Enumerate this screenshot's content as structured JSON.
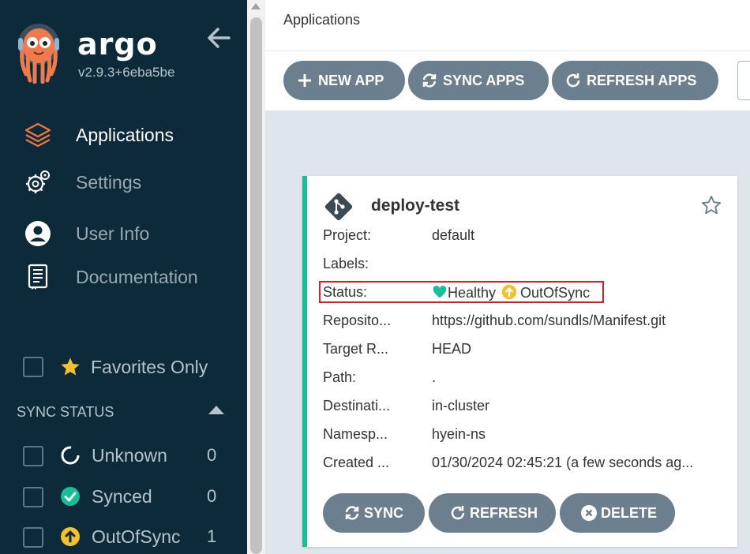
{
  "sidebar": {
    "brand": "argo",
    "version": "v2.9.3+6eba5be",
    "nav": [
      {
        "label": "Applications",
        "icon": "stack-icon",
        "active": true
      },
      {
        "label": "Settings",
        "icon": "gear-icon"
      },
      {
        "label": "User Info",
        "icon": "user-icon"
      },
      {
        "label": "Documentation",
        "icon": "book-icon"
      }
    ],
    "favorites_label": "Favorites Only",
    "sync_status_header": "SYNC STATUS",
    "sync_status": [
      {
        "label": "Unknown",
        "count": "0"
      },
      {
        "label": "Synced",
        "count": "0"
      },
      {
        "label": "OutOfSync",
        "count": "1"
      }
    ]
  },
  "header": {
    "title": "Applications"
  },
  "toolbar": {
    "new_app": "NEW APP",
    "sync_apps": "SYNC APPS",
    "refresh_apps": "REFRESH APPS"
  },
  "app_card": {
    "name": "deploy-test",
    "fields": [
      {
        "key": "Project:",
        "value": "default"
      },
      {
        "key": "Labels:",
        "value": ""
      },
      {
        "key": "Status:",
        "value": ""
      },
      {
        "key": "Reposito...",
        "value": "https://github.com/sundls/Manifest.git"
      },
      {
        "key": "Target R...",
        "value": "HEAD"
      },
      {
        "key": "Path:",
        "value": "."
      },
      {
        "key": "Destinati...",
        "value": "in-cluster"
      },
      {
        "key": "Namesp...",
        "value": "hyein-ns"
      },
      {
        "key": "Created ...",
        "value": "01/30/2024 02:45:21  (a few seconds ag..."
      }
    ],
    "health_status": "Healthy",
    "sync_status": "OutOfSync",
    "buttons": {
      "sync": "SYNC",
      "refresh": "REFRESH",
      "delete": "DELETE"
    }
  },
  "colors": {
    "sidebar_bg": "#0d2a3a",
    "accent_orange": "#ee7742",
    "healthy_green": "#18be94",
    "outofsync_yellow": "#f4c030",
    "button_gray": "#6b7f8e",
    "content_bg": "#dfe6eb",
    "highlight_red": "#d11f26"
  }
}
